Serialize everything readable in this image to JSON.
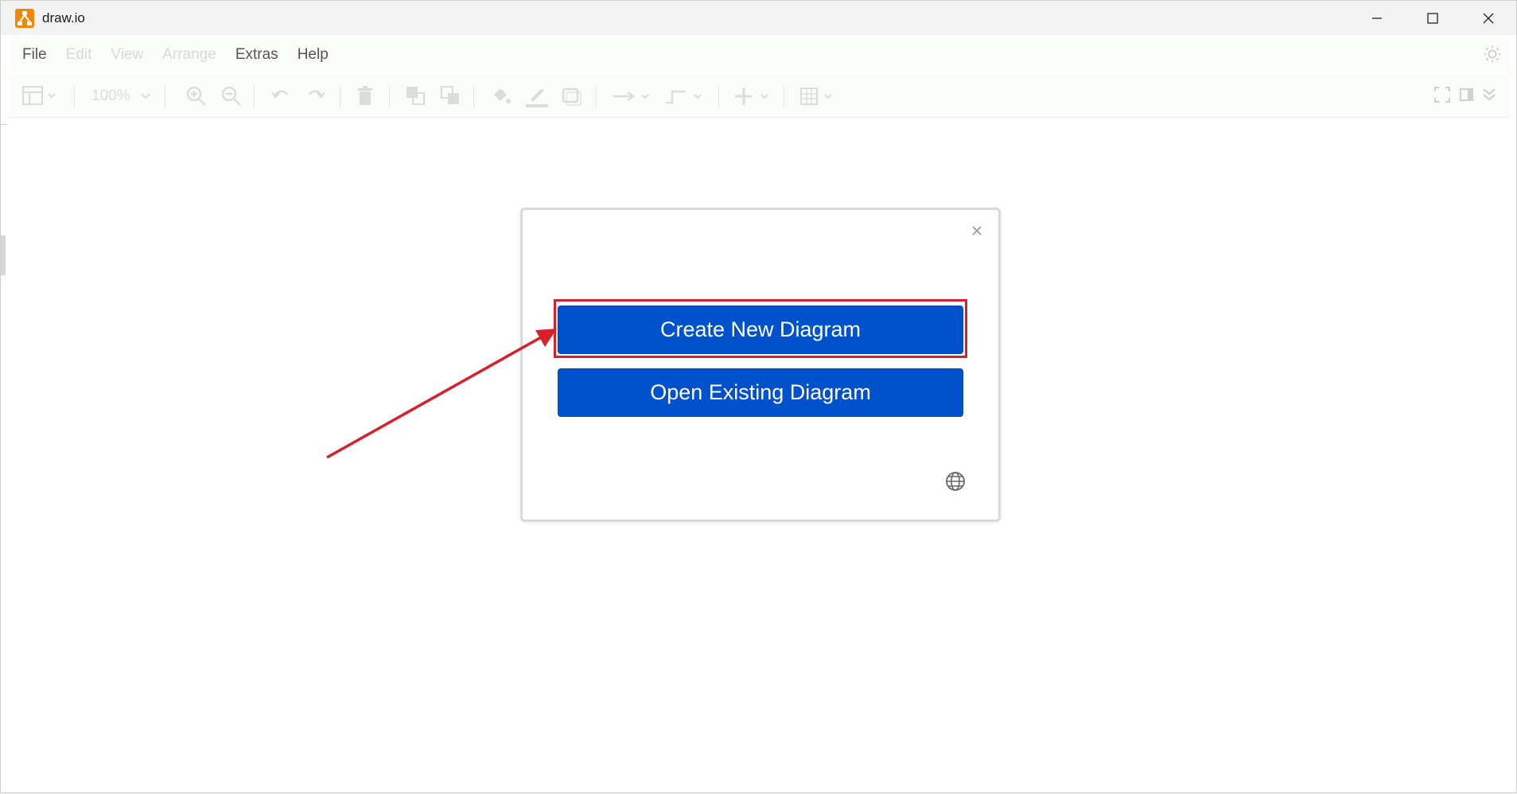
{
  "window": {
    "title": "draw.io"
  },
  "menu": {
    "items": [
      {
        "label": "File",
        "enabled": true
      },
      {
        "label": "Edit",
        "enabled": false
      },
      {
        "label": "View",
        "enabled": false
      },
      {
        "label": "Arrange",
        "enabled": false
      },
      {
        "label": "Extras",
        "enabled": true
      },
      {
        "label": "Help",
        "enabled": true
      }
    ]
  },
  "toolbar": {
    "zoom": "100%"
  },
  "dialog": {
    "close_glyph": "×",
    "create_label": "Create New Diagram",
    "open_label": "Open Existing Diagram"
  },
  "annotation": {
    "color": "#d9202a"
  },
  "colors": {
    "button_bg": "#0052cc",
    "logo": "#f08705"
  }
}
